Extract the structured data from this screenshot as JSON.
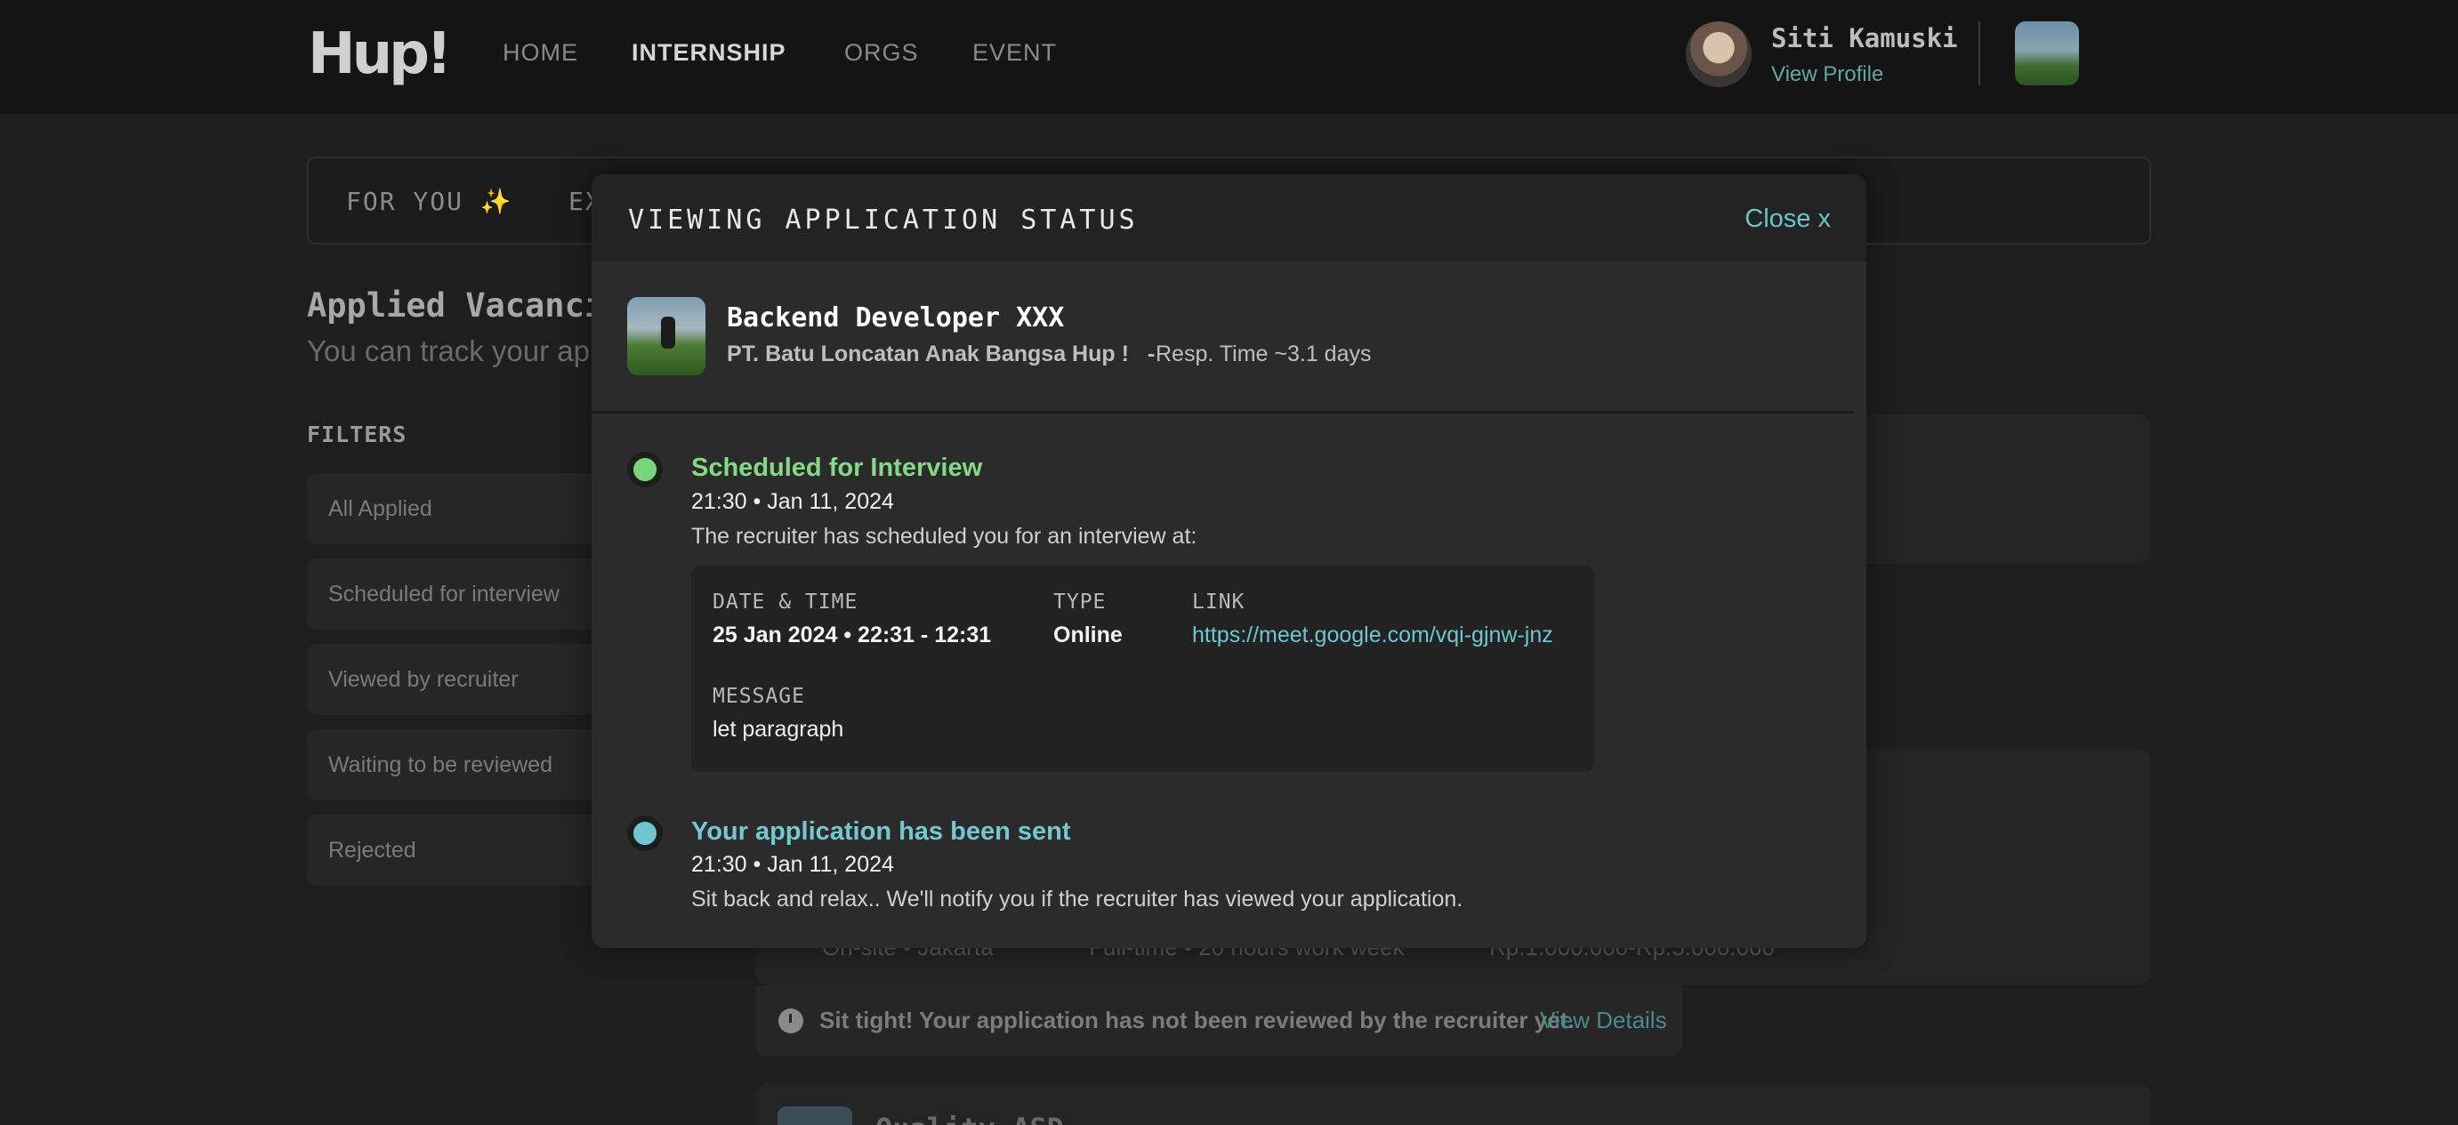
{
  "nav": {
    "logo": "Hup!",
    "items": [
      {
        "label": "HOME"
      },
      {
        "label": "INTERNSHIP"
      },
      {
        "label": "ORGS"
      },
      {
        "label": "EVENT"
      }
    ],
    "user_name": "Siti Kamuski",
    "view_profile": "View Profile"
  },
  "tabs": {
    "for_you": "FOR YOU ✨",
    "explore": "EX"
  },
  "applied": {
    "title": "Applied Vacancie",
    "subtitle": "You can track your app"
  },
  "filters": {
    "label": "FILTERS",
    "items": [
      "All Applied",
      "Scheduled for interview",
      "Viewed by recruiter",
      "Waiting to be reviewed",
      "Rejected"
    ]
  },
  "background_card": {
    "meta_location": "On-site • Jakarta",
    "meta_type": "Full-time • 20 hours work week",
    "meta_salary": "Rp.1.000.000-Rp.5.000.000",
    "notice": "Sit tight! Your application has not been reviewed by the recruiter yet.",
    "notice_link": "View Details",
    "next_title": "Quality ASD"
  },
  "modal": {
    "title": "VIEWING APPLICATION STATUS",
    "close": "Close x",
    "job": {
      "title": "Backend Developer XXX",
      "company": "PT. Batu Loncatan Anak Bangsa Hup !",
      "separator": "-",
      "resp_time": "Resp. Time ~3.1 days"
    },
    "steps": [
      {
        "title": "Scheduled for Interview",
        "time": "21:30 • Jan 11, 2024",
        "description": "The recruiter has scheduled you for an interview at:",
        "color": "#84d984"
      },
      {
        "title": "Your application has been sent",
        "time": "21:30 • Jan 11, 2024",
        "description": "Sit back and relax.. We'll notify you if the recruiter has viewed your application.",
        "color": "#74c8d0"
      }
    ],
    "interview": {
      "datetime_label": "DATE & TIME",
      "datetime_value": "25 Jan 2024 • 22:31 - 12:31",
      "type_label": "TYPE",
      "type_value": "Online",
      "link_label": "LINK",
      "link_value": "https://meet.google.com/vqi-gjnw-jnz",
      "message_label": "MESSAGE",
      "message_value": "let paragraph"
    }
  }
}
